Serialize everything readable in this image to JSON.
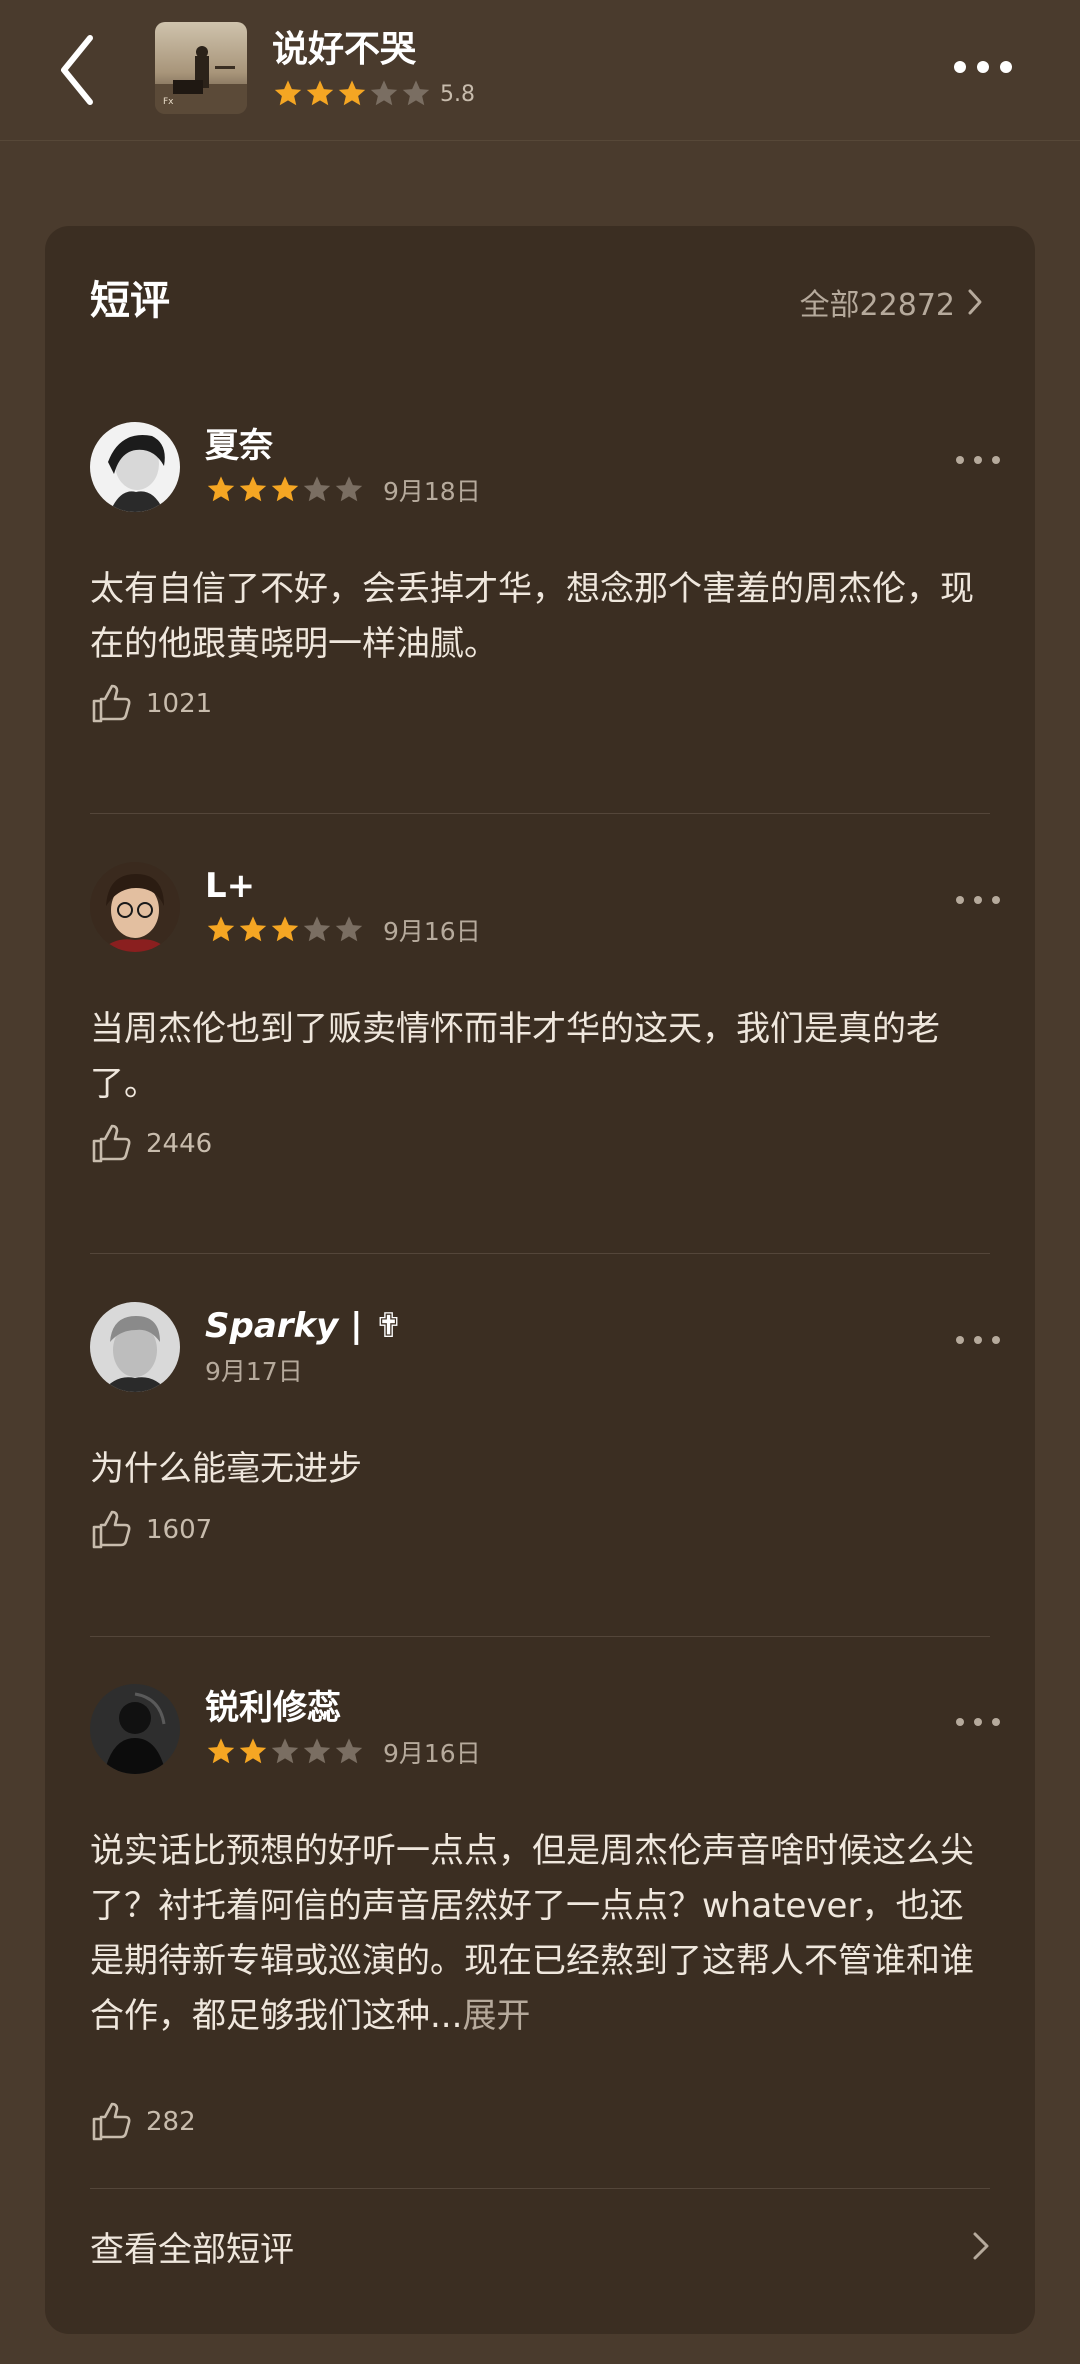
{
  "header": {
    "title": "说好不哭",
    "rating": 3,
    "score": "5.8",
    "icons": {
      "back": "back-arrow-icon",
      "more": "more-dots-icon"
    }
  },
  "section": {
    "title": "短评",
    "all_label": "全部22872"
  },
  "reviews": [
    {
      "user": "夏奈",
      "stars": 3,
      "date": "9月18日",
      "text": "太有自信了不好，会丢掉才华，想念那个害羞的周杰伦，现在的他跟黄晓明一样油腻。",
      "likes": "1021"
    },
    {
      "user": "L+",
      "stars": 3,
      "date": "9月16日",
      "text": "当周杰伦也到了贩卖情怀而非才华的这天，我们是真的老了。",
      "likes": "2446"
    },
    {
      "user": "Sparky | ✟",
      "stars": 0,
      "date": "9月17日",
      "text": "为什么能毫无进步",
      "likes": "1607"
    },
    {
      "user": "锐利修蕊",
      "stars": 2,
      "date": "9月16日",
      "text": "说实话比预想的好听一点点，但是周杰伦声音啥时候这么尖了？衬托着阿信的声音居然好了一点点？whatever，也还是期待新专辑或巡演的。现在已经熬到了这帮人不管谁和谁合作，都足够我们这种...",
      "expand": "展开",
      "likes": "282"
    }
  ],
  "footer": {
    "label": "查看全部短评"
  },
  "colors": {
    "star_on": "#f5a623",
    "star_off": "#7a6e62",
    "background": "#4a3b2d",
    "card": "#3b2e22"
  }
}
